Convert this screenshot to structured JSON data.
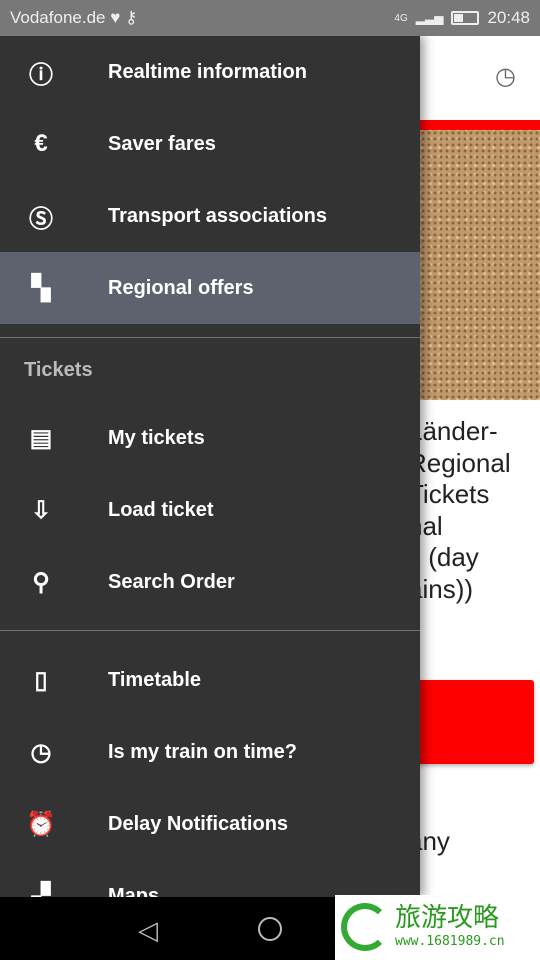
{
  "status": {
    "carrier": "Vodafone.de",
    "network": "4G",
    "time": "20:48",
    "battery_percent": 35
  },
  "background": {
    "desc_lines": [
      "Länder-",
      "Regional",
      "Tickets",
      "nal",
      "s (day",
      "ains))"
    ],
    "trailing_text": "any",
    "accent": "#ff0000"
  },
  "drawer": {
    "items_top": [
      {
        "icon": "realtime-info-icon",
        "glyph": "ⓘ",
        "label": "Realtime information"
      },
      {
        "icon": "saver-fares-icon",
        "glyph": "€",
        "label": "Saver fares"
      },
      {
        "icon": "transport-associations-icon",
        "glyph": "Ⓢ",
        "label": "Transport associations"
      },
      {
        "icon": "regional-offers-icon",
        "glyph": "▚",
        "label": "Regional offers",
        "selected": true
      }
    ],
    "tickets_header": "Tickets",
    "items_tickets": [
      {
        "icon": "my-tickets-icon",
        "glyph": "▤",
        "label": "My tickets"
      },
      {
        "icon": "load-ticket-icon",
        "glyph": "⇩",
        "label": "Load ticket"
      },
      {
        "icon": "search-icon",
        "glyph": "⚲",
        "label": "Search Order"
      }
    ],
    "items_bottom": [
      {
        "icon": "timetable-icon",
        "glyph": "▯",
        "label": "Timetable"
      },
      {
        "icon": "train-on-time-icon",
        "glyph": "◷",
        "label": "Is my train on time?"
      },
      {
        "icon": "alarm-clock-icon",
        "glyph": "⏰",
        "label": "Delay Notifications"
      },
      {
        "icon": "map-icon",
        "glyph": "▞",
        "label": "Maps"
      }
    ]
  },
  "watermark": {
    "text": "旅游攻略",
    "url": "www.1681989.cn"
  }
}
